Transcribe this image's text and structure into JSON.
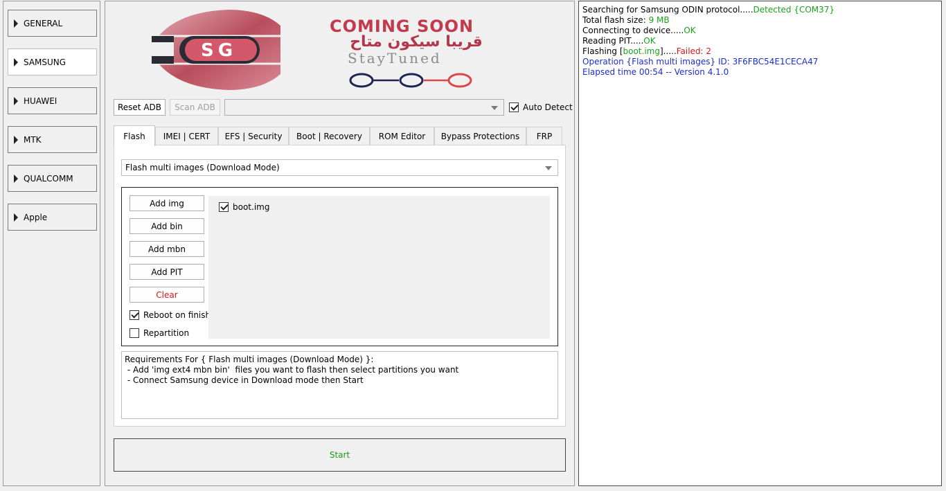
{
  "sidebar": {
    "items": [
      {
        "label": "GENERAL"
      },
      {
        "label": "SAMSUNG"
      },
      {
        "label": "HUAWEI"
      },
      {
        "label": "MTK"
      },
      {
        "label": "QUALCOMM"
      },
      {
        "label": "Apple"
      }
    ],
    "active": "SAMSUNG"
  },
  "banner": {
    "logo_letters": "SG",
    "coming_soon": "COMING SOON",
    "arabic": "قريبا سيكون متاح",
    "stay_tuned": "StayTuned"
  },
  "adb": {
    "reset_label": "Reset ADB",
    "scan_label": "Scan ADB",
    "port_value": "",
    "auto_detect_label": "Auto Detect",
    "auto_detect_checked": true
  },
  "tabs": [
    {
      "label": "Flash"
    },
    {
      "label": "IMEI | CERT"
    },
    {
      "label": "EFS | Security"
    },
    {
      "label": "Boot | Recovery"
    },
    {
      "label": "ROM Editor"
    },
    {
      "label": "Bypass Protections"
    },
    {
      "label": "FRP"
    }
  ],
  "flash": {
    "mode_value": "Flash multi images (Download Mode)",
    "buttons": {
      "add_img": "Add img",
      "add_bin": "Add bin",
      "add_mbn": "Add mbn",
      "add_pit": "Add PIT",
      "clear": "Clear"
    },
    "reboot_label": "Reboot on finish",
    "reboot_checked": true,
    "repartition_label": "Repartition",
    "repartition_checked": false,
    "files": [
      {
        "name": "boot.img",
        "checked": true
      }
    ],
    "requirements": [
      "Requirements For { Flash multi images (Download Mode) }:",
      " - Add 'img ext4 mbn bin'  files you want to flash then select partitions you want",
      " - Connect Samsung device in Download mode then Start"
    ],
    "start_label": "Start"
  },
  "log": {
    "l1_text": "Searching for Samsung ODIN protocol.....",
    "l1_status": "Detected {COM37}",
    "l2_text": "Total flash size: ",
    "l2_value": "9 MB",
    "l3_text": "Connecting to device.....",
    "l3_status": "OK",
    "l4_text": "Reading PIT.....",
    "l4_status": "OK",
    "l5_text": "Flashing [",
    "l5_file": "boot.img",
    "l5_mid": "].....",
    "l5_status": "Failed: 2",
    "l6_text": "Operation {Flash multi images} ID: 3F6FBC54E1CECA47",
    "l7_text": "Elapsed time 00:54 -- Version 4.1.0"
  },
  "colors": {
    "ok_green": "#1aa31a",
    "error_red": "#d01818",
    "info_blue": "#1a2ecc"
  }
}
